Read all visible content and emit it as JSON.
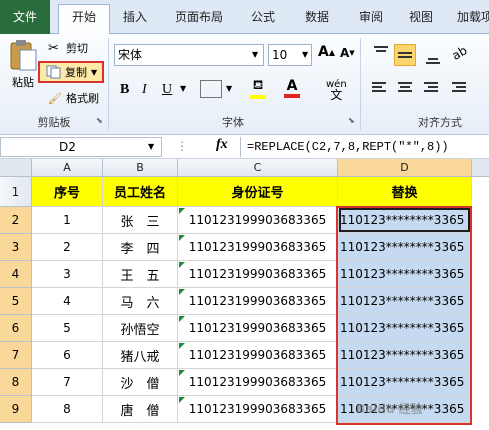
{
  "tabs": [
    "文件",
    "开始",
    "插入",
    "页面布局",
    "公式",
    "数据",
    "审阅",
    "视图",
    "加载项"
  ],
  "clipboard": {
    "paste": "粘贴",
    "cut": "剪切",
    "copy": "复制",
    "format_painter": "格式刷",
    "group": "剪贴板"
  },
  "font": {
    "name": "宋体",
    "size": "10",
    "group": "字体",
    "bold": "B",
    "italic": "I",
    "underline": "U",
    "wen": "wén"
  },
  "align": {
    "group": "对齐方式"
  },
  "formula_bar": {
    "name_box": "D2",
    "fx": "fx",
    "formula": "=REPLACE(C2,7,8,REPT(\"*\",8))"
  },
  "columns": [
    "A",
    "B",
    "C",
    "D"
  ],
  "rows": [
    "1",
    "2",
    "3",
    "4",
    "5",
    "6",
    "7",
    "8",
    "9"
  ],
  "headers": [
    "序号",
    "员工姓名",
    "身份证号",
    "替换"
  ],
  "data": [
    [
      "1",
      "张　三",
      "110123199903683365",
      "110123********3365"
    ],
    [
      "2",
      "李　四",
      "110123199903683365",
      "110123********3365"
    ],
    [
      "3",
      "王　五",
      "110123199903683365",
      "110123********3365"
    ],
    [
      "4",
      "马　六",
      "110123199903683365",
      "110123********3365"
    ],
    [
      "5",
      "孙悟空",
      "110123199903683365",
      "110123********3365"
    ],
    [
      "6",
      "猪八戒",
      "110123199903683365",
      "110123********3365"
    ],
    [
      "7",
      "沙　僧",
      "110123199903683365",
      "110123********3365"
    ],
    [
      "8",
      "唐　僧",
      "110123199903683365",
      "110123********3365"
    ]
  ],
  "colors": {
    "header_fill": "#ffff00",
    "selection": "#c5daf0",
    "highlight_border": "#d9332b",
    "file_tab": "#2a6c3b"
  },
  "watermark": "Baidu 经验"
}
